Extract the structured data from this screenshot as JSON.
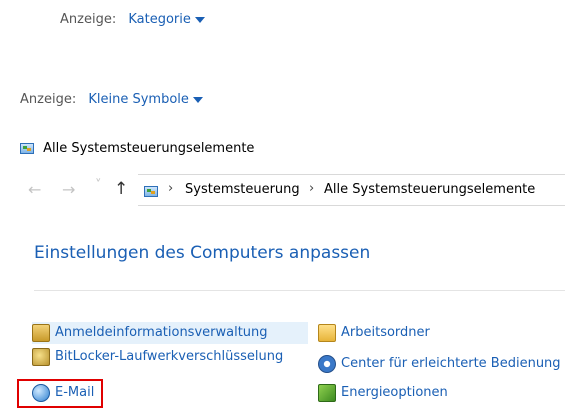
{
  "view_top": {
    "label": "Anzeige:",
    "value": "Kategorie"
  },
  "view_mid": {
    "label": "Anzeige:",
    "value": "Kleine Symbole"
  },
  "title_row": {
    "text": "Alle Systemsteuerungselemente"
  },
  "address_bar": {
    "crumbs": [
      "Systemsteuerung",
      "Alle Systemsteuerungselemente"
    ],
    "separator": "›",
    "back_glyph": "←",
    "forward_glyph": "→",
    "dropdown_glyph": "˅",
    "up_glyph": "↑"
  },
  "heading": "Einstellungen des Computers anpassen",
  "items_left": [
    {
      "label": "Anmeldeinformationsverwaltung",
      "icon": "credential-manager-icon"
    },
    {
      "label": "BitLocker-Laufwerkverschlüsselung",
      "icon": "bitlocker-icon"
    },
    {
      "label": "E-Mail",
      "icon": "mail-icon"
    }
  ],
  "items_right": [
    {
      "label": "Arbeitsordner",
      "icon": "work-folders-icon"
    },
    {
      "label": "Center für erleichterte Bedienung",
      "icon": "ease-of-access-icon"
    },
    {
      "label": "Energieoptionen",
      "icon": "power-options-icon"
    }
  ],
  "colors": {
    "link": "#1a5fb4",
    "highlight": "#e5f1fb",
    "annotation_box": "#e00000"
  }
}
